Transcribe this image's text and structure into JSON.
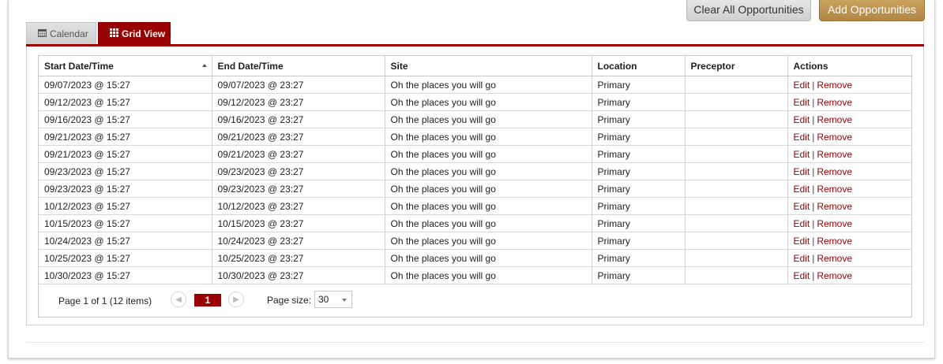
{
  "toolbar": {
    "clear_label": "Clear All Opportunities",
    "add_label": "Add Opportunities"
  },
  "tabs": [
    {
      "label": "Calendar",
      "icon": "calendar-icon"
    },
    {
      "label": "Grid View",
      "icon": "grid-icon"
    }
  ],
  "colors": {
    "accent": "#9b0000",
    "add_button": "#b08643",
    "link": "#9b0000"
  },
  "table": {
    "columns": [
      "Start Date/Time",
      "End Date/Time",
      "Site",
      "Location",
      "Preceptor",
      "Actions"
    ],
    "action_edit": "Edit",
    "action_remove": "Remove",
    "action_separator": "|",
    "rows": [
      {
        "start": "09/07/2023 @ 15:27",
        "end": "09/07/2023 @ 23:27",
        "site": "Oh the places you will go",
        "location": "Primary",
        "preceptor": ""
      },
      {
        "start": "09/12/2023 @ 15:27",
        "end": "09/12/2023 @ 23:27",
        "site": "Oh the places you will go",
        "location": "Primary",
        "preceptor": ""
      },
      {
        "start": "09/16/2023 @ 15:27",
        "end": "09/16/2023 @ 23:27",
        "site": "Oh the places you will go",
        "location": "Primary",
        "preceptor": ""
      },
      {
        "start": "09/21/2023 @ 15:27",
        "end": "09/21/2023 @ 23:27",
        "site": "Oh the places you will go",
        "location": "Primary",
        "preceptor": ""
      },
      {
        "start": "09/21/2023 @ 15:27",
        "end": "09/21/2023 @ 23:27",
        "site": "Oh the places you will go",
        "location": "Primary",
        "preceptor": ""
      },
      {
        "start": "09/23/2023 @ 15:27",
        "end": "09/23/2023 @ 23:27",
        "site": "Oh the places you will go",
        "location": "Primary",
        "preceptor": ""
      },
      {
        "start": "09/23/2023 @ 15:27",
        "end": "09/23/2023 @ 23:27",
        "site": "Oh the places you will go",
        "location": "Primary",
        "preceptor": ""
      },
      {
        "start": "10/12/2023 @ 15:27",
        "end": "10/12/2023 @ 23:27",
        "site": "Oh the places you will go",
        "location": "Primary",
        "preceptor": ""
      },
      {
        "start": "10/15/2023 @ 15:27",
        "end": "10/15/2023 @ 23:27",
        "site": "Oh the places you will go",
        "location": "Primary",
        "preceptor": ""
      },
      {
        "start": "10/24/2023 @ 15:27",
        "end": "10/24/2023 @ 23:27",
        "site": "Oh the places you will go",
        "location": "Primary",
        "preceptor": ""
      },
      {
        "start": "10/25/2023 @ 15:27",
        "end": "10/25/2023 @ 23:27",
        "site": "Oh the places you will go",
        "location": "Primary",
        "preceptor": ""
      },
      {
        "start": "10/30/2023 @ 15:27",
        "end": "10/30/2023 @ 23:27",
        "site": "Oh the places you will go",
        "location": "Primary",
        "preceptor": ""
      }
    ]
  },
  "pager": {
    "info": "Page 1 of 1 (12 items)",
    "current_page": "1",
    "page_size_label": "Page size:",
    "page_size_value": "30"
  }
}
